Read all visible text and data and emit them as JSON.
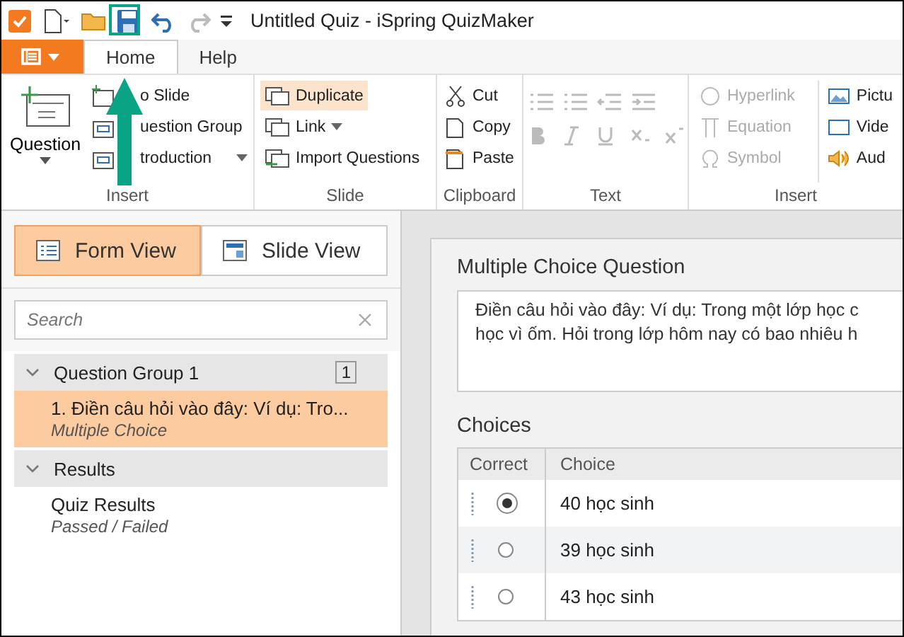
{
  "window": {
    "title": "Untitled Quiz - iSpring QuizMaker"
  },
  "tabs": [
    {
      "label": "Home",
      "selected": true
    },
    {
      "label": "Help",
      "selected": false
    }
  ],
  "ribbon": {
    "insert": {
      "big_button": {
        "label": "Question"
      },
      "items": [
        {
          "label": "o Slide",
          "caret": false
        },
        {
          "label": "uestion Group",
          "caret": false
        },
        {
          "label": "troduction",
          "caret": true
        }
      ],
      "label": "Insert"
    },
    "slide": {
      "items": [
        {
          "label": "Duplicate",
          "selected": true,
          "caret": false
        },
        {
          "label": "Link",
          "selected": false,
          "caret": true
        },
        {
          "label": "Import Questions",
          "selected": false,
          "caret": false
        }
      ],
      "label": "Slide"
    },
    "clipboard": {
      "items": [
        {
          "label": "Cut"
        },
        {
          "label": "Copy"
        },
        {
          "label": "Paste"
        }
      ],
      "label": "Clipboard"
    },
    "text": {
      "label": "Text"
    },
    "insert_media": {
      "items": [
        {
          "label": "Hyperlink",
          "disabled": true
        },
        {
          "label": "Equation",
          "disabled": true
        },
        {
          "label": "Symbol",
          "disabled": true
        }
      ],
      "media": [
        {
          "label": "Pictu"
        },
        {
          "label": "Vide"
        },
        {
          "label": "Aud"
        }
      ],
      "label": "Insert"
    }
  },
  "views": [
    {
      "label": "Form View",
      "selected": true
    },
    {
      "label": "Slide View",
      "selected": false
    }
  ],
  "search": {
    "placeholder": "Search"
  },
  "tree": [
    {
      "title": "Question Group 1",
      "count": "1",
      "expanded": true,
      "children": [
        {
          "title": "1. Điền câu hỏi vào đây: Ví dụ: Tro...",
          "subtitle": "Multiple Choice",
          "selected": true
        }
      ]
    },
    {
      "title": "Results",
      "expanded": true,
      "children": [
        {
          "title": "Quiz Results",
          "subtitle": "Passed / Failed",
          "selected": false
        }
      ]
    }
  ],
  "editor": {
    "heading": "Multiple Choice Question",
    "question_lines": [
      "Điền câu hỏi vào đây: Ví dụ: Trong một lớp học c",
      "học vì ốm. Hỏi trong lớp hôm nay có bao nhiêu h"
    ],
    "choices_heading": "Choices",
    "columns": [
      "Correct",
      "Choice"
    ],
    "choices": [
      {
        "text": "40 học sinh",
        "selected": true
      },
      {
        "text": "39 học sinh",
        "selected": false
      },
      {
        "text": "43 học sinh",
        "selected": false
      }
    ]
  }
}
